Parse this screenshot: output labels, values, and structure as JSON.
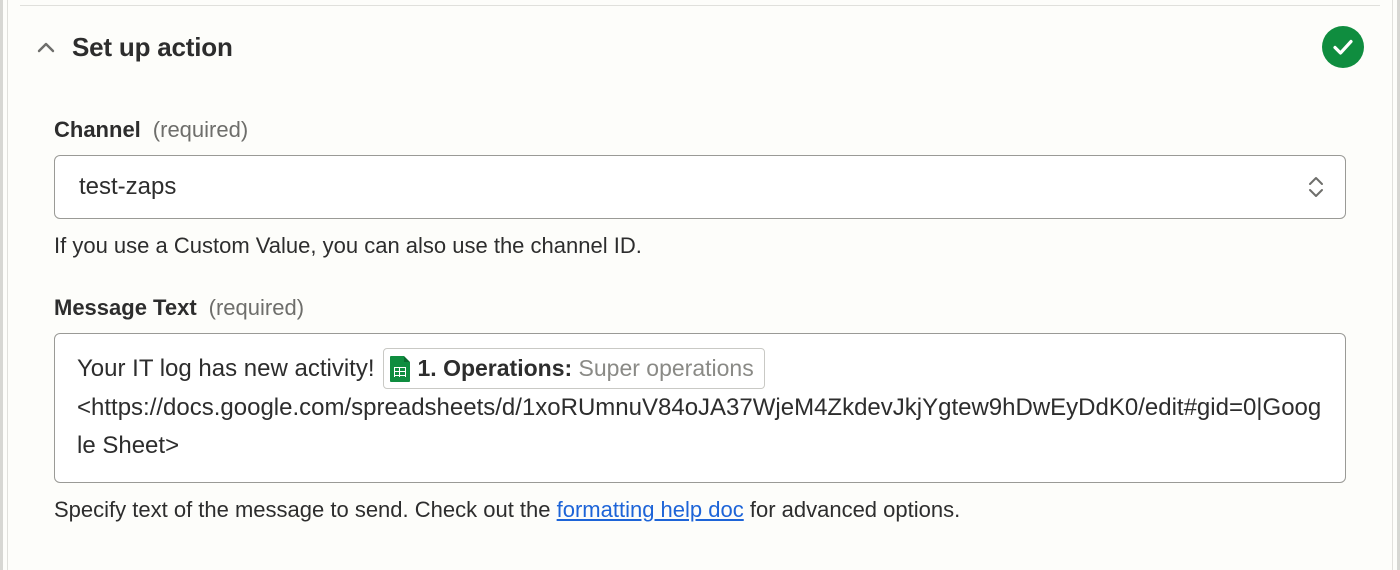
{
  "section": {
    "title": "Set up action",
    "status": "complete"
  },
  "fields": {
    "channel": {
      "label": "Channel",
      "required_text": "(required)",
      "value": "test-zaps",
      "helper": "If you use a Custom Value, you can also use the channel ID."
    },
    "message": {
      "label": "Message Text",
      "required_text": "(required)",
      "text_prefix": "Your IT log has new activity!",
      "pill": {
        "step": "1.",
        "source": "Operations:",
        "value": "Super operations"
      },
      "text_line2": "<https://docs.google.com/spreadsheets/d/1xoRUmnuV84oJA37WjeM4ZkdevJkjYgtew9hDwEyDdK0/edit#gid=0|Google Sheet>",
      "helper_pre": "Specify text of the message to send. Check out the ",
      "helper_link": "formatting help doc",
      "helper_post": " for advanced options."
    }
  }
}
